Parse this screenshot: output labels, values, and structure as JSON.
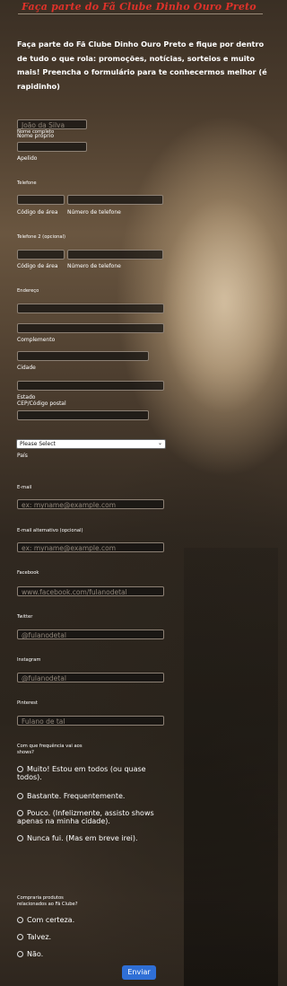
{
  "header": {
    "title": "Faça parte do Fã Clube Dinho Ouro Preto"
  },
  "intro": "Faça parte do  Fã Clube  Dinho Ouro  Preto e fique por dentro de tudo o que rola: promoções, notícias, sorteios e muito mais!  Preencha o formulário para te conhecermos melhor (é rapidinho)",
  "form": {
    "name": {
      "label": "Nome completo",
      "first_placeholder": "João da Silva",
      "first_sub": "Nome próprio",
      "last_sub": "Apelido"
    },
    "phone": {
      "label": "Telefone",
      "area_sub": "Código de área",
      "number_sub": "Número de telefone"
    },
    "phone2": {
      "label": "Telefone 2 (opcional)",
      "area_sub": "Código de área",
      "number_sub": "Número de telefone"
    },
    "address": {
      "label": "Endereço",
      "complement_sub": "Complemento",
      "city_sub": "Cidade",
      "state_sub": "Estado",
      "zip_sub": "CEP/Código postal",
      "country_value": "Please Select",
      "country_sub": "País"
    },
    "email": {
      "label": "E-mail",
      "placeholder": "ex: myname@example.com"
    },
    "email_alt": {
      "label": "E-mail alternativo (opcional)",
      "placeholder": "ex: myname@example.com"
    },
    "facebook": {
      "label": "Facebook",
      "placeholder": "www.facebook.com/fulanodetal"
    },
    "twitter": {
      "label": "Twitter",
      "placeholder": "@fulanodetal"
    },
    "instagram": {
      "label": "Instagram",
      "placeholder": "@fulanodetal"
    },
    "pinterest": {
      "label": "Pinterest",
      "placeholder": "Fulano de tal"
    },
    "shows": {
      "question": "Com que frequência vai aos shows?",
      "options": [
        "Muito!  Estou em todos (ou quase todos).",
        "Bastante.  Frequentemente.",
        "Pouco. (Infelizmente, assisto shows apenas na minha cidade).",
        "Nunca fui. (Mas em breve irei)."
      ]
    },
    "products": {
      "question": "Compraria produtos relacionados ao  Fã Clube?",
      "options": [
        "Com certeza.",
        "Talvez.",
        "Não."
      ]
    },
    "submit_label": "Enviar"
  }
}
